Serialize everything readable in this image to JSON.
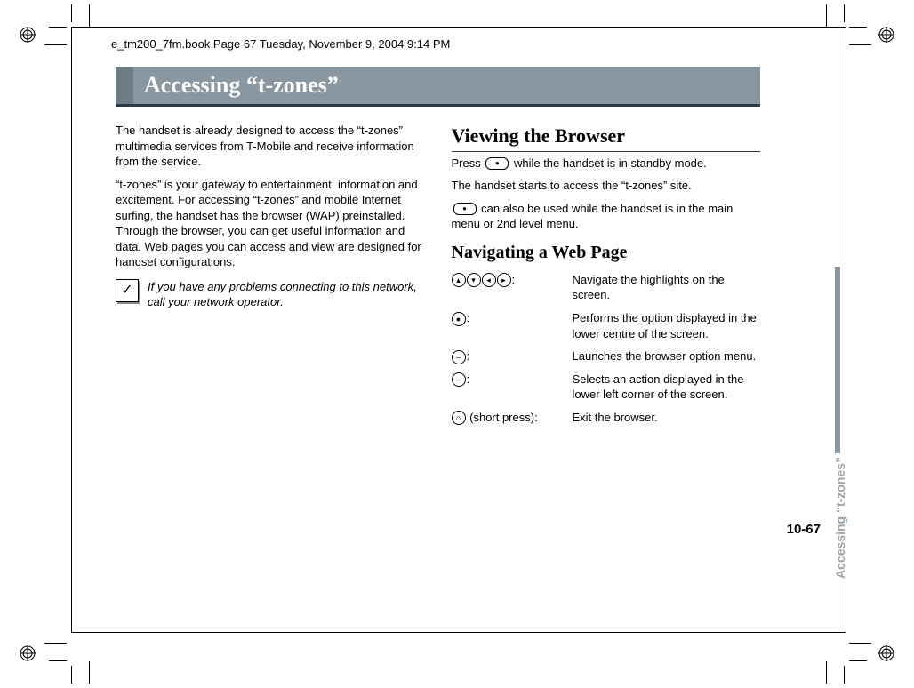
{
  "book_header": "e_tm200_7fm.book  Page 67  Tuesday, November 9, 2004  9:14 PM",
  "title": "Accessing “t-zones”",
  "left": {
    "p1": "The handset is already designed to access the “t-zones” multimedia services from T-Mobile and receive information from the service.",
    "p2": "“t-zones” is your gateway to entertainment, information and excitement. For accessing “t-zones” and mobile Internet surfing, the handset has the browser (WAP) preinstalled. Through the browser, you can get useful information and data. Web pages you can access and view are designed for handset configurations.",
    "note": "If you have any problems connecting to this network, call your network operator."
  },
  "right": {
    "h2": "Viewing the Browser",
    "p1a": "Press ",
    "p1b": " while the handset is in standby mode.",
    "p2": "The handset starts to access the “t-zones” site.",
    "p3b": " can also be used while the handset is in the main menu or 2nd level menu.",
    "h3": "Navigating a Web Page",
    "nav": [
      {
        "desc": "Navigate the highlights on the screen."
      },
      {
        "desc": "Performs the option displayed in the lower centre of the screen."
      },
      {
        "desc": "Launches the browser option menu."
      },
      {
        "desc": "Selects an action displayed in the lower left corner of the screen."
      },
      {
        "key_suffix": " (short press):",
        "desc": "Exit the browser."
      }
    ]
  },
  "side_tab": "Accessing “t-zones”",
  "page_number": "10-67"
}
